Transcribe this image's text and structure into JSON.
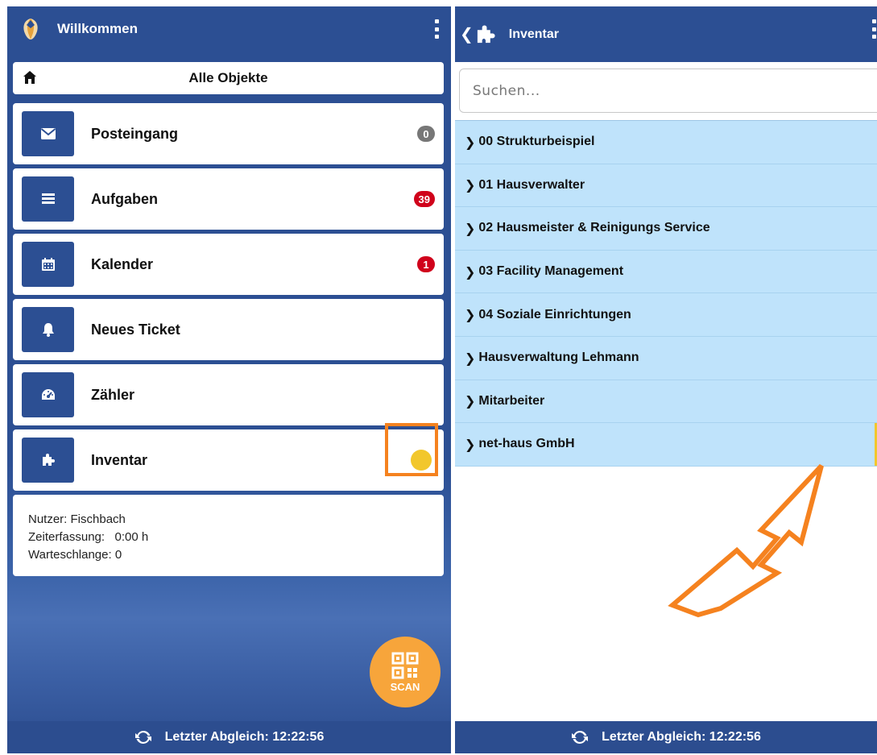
{
  "left": {
    "header": {
      "title": "Willkommen"
    },
    "all_objects": {
      "label": "Alle Objekte"
    },
    "menu": [
      {
        "label": "Posteingang",
        "badge": "0",
        "icon": "envelope-icon"
      },
      {
        "label": "Aufgaben",
        "badge": "39",
        "icon": "list-icon"
      },
      {
        "label": "Kalender",
        "badge": "1",
        "icon": "calendar-icon"
      },
      {
        "label": "Neues Ticket",
        "icon": "bell-icon"
      },
      {
        "label": "Zähler",
        "icon": "gauge-icon"
      },
      {
        "label": "Inventar",
        "icon": "puzzle-icon"
      }
    ],
    "info": {
      "user": "Nutzer: Fischbach",
      "time": "Zeiterfassung:   0:00 h",
      "queue": "Warteschlange: 0"
    },
    "scan_label": "SCAN",
    "footer": "Letzter Abgleich: 12:22:56"
  },
  "right": {
    "header": {
      "title": "Inventar"
    },
    "search": {
      "placeholder": "Suchen..."
    },
    "items": [
      "00 Strukturbeispiel",
      "01 Hausverwalter",
      "02 Hausmeister & Reinigungs Service",
      "03 Facility Management",
      "04 Soziale Einrichtungen",
      "Hausverwaltung Lehmann",
      "Mitarbeiter",
      "net-haus GmbH"
    ],
    "footer": "Letzter Abgleich: 12:22:56"
  },
  "colors": {
    "primary": "#2c4f93",
    "badge_red": "#d0021b",
    "badge_gray": "#777777",
    "list_bg": "#bfe3fb",
    "accent_orange": "#f5821f",
    "scan_orange": "#f7a53b",
    "status_yellow": "#f2c72c"
  }
}
